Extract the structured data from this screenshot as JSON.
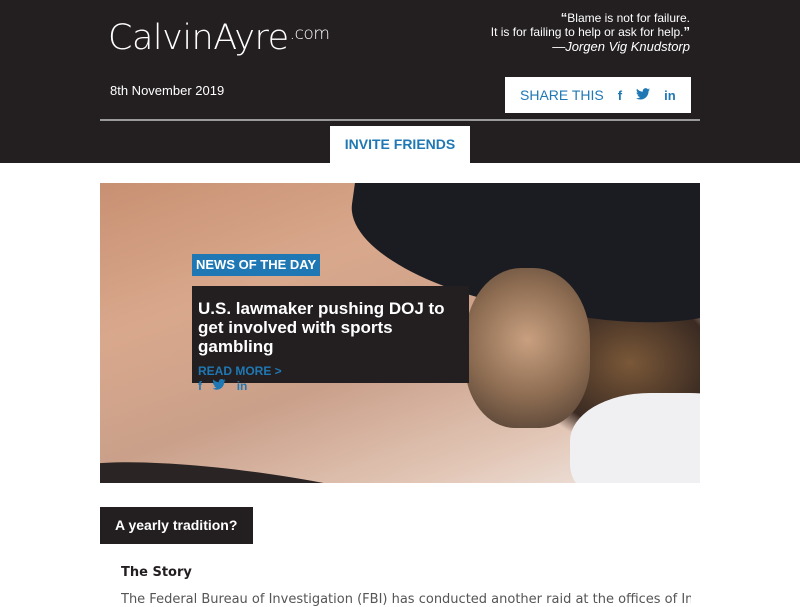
{
  "header": {
    "logo_main": "CalvinAyre",
    "logo_suffix": ".com",
    "quote_line1": "Blame is not for failure.",
    "quote_line2": "It is for failing to help or ask for help.",
    "quote_open": "❝",
    "quote_close": "❞",
    "quote_author": "—Jorgen Vig Knudstorp",
    "date": "8th November 2019",
    "share_label": "SHARE THIS",
    "share_icons": {
      "facebook": "f",
      "twitter": "🐦",
      "linkedin": "in"
    },
    "invite_label": "INVITE FRIENDS"
  },
  "hero": {
    "tag": "NEWS OF THE DAY",
    "headline": "U.S. lawmaker pushing DOJ to get involved with sports gambling",
    "read_more": "READ MORE >",
    "social": {
      "facebook": "f",
      "twitter": "t",
      "linkedin": "in"
    }
  },
  "section": {
    "title": "A yearly tradition?",
    "subtitle": "The Story",
    "body": "The Federal Bureau of Investigation (FBI) has conducted another raid at the offices of Imperial"
  },
  "colors": {
    "dark": "#231f20",
    "accent": "#1f78b4"
  }
}
